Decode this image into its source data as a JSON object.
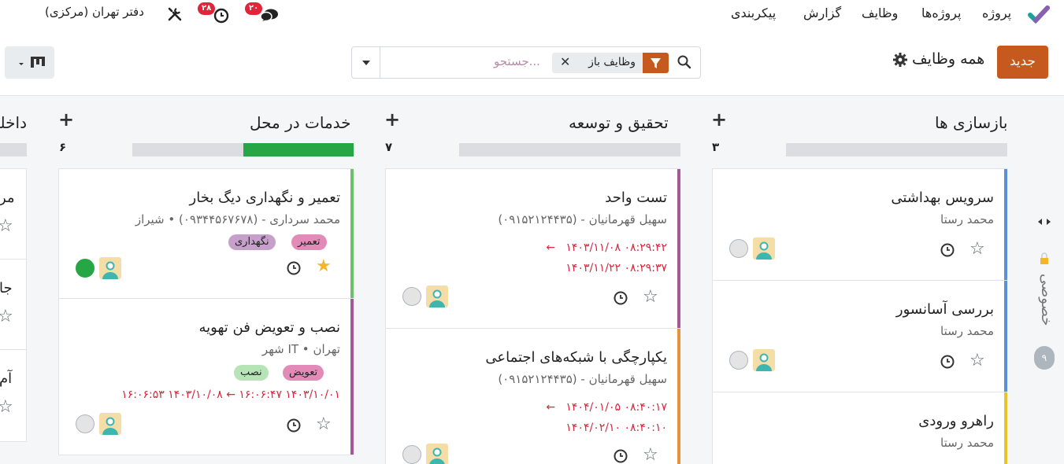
{
  "navbar": {
    "app_name": "پروژه",
    "menu": [
      "پروژه‌ها",
      "وظایف",
      "گزارش",
      "پیکربندی"
    ],
    "company": "دفتر تهران (مرکزی)",
    "messages_count": "۲۰",
    "activities_count": "۲۸"
  },
  "control": {
    "new_button": "جدید",
    "breadcrumb": "همه وظایف",
    "search_placeholder": "جستجو...",
    "facet_label": "وظایف باز",
    "accent_color": "#c65a1e"
  },
  "columns": [
    {
      "title": "بازسازی ها",
      "count": "۳",
      "progress_done": 0
    },
    {
      "title": "تحقیق و توسعه",
      "count": "۷",
      "progress_done": 0
    },
    {
      "title": "خدمات در محل",
      "count": "۶",
      "progress_done": 0.5
    },
    {
      "title": "داخلی",
      "count": ""
    }
  ],
  "cards": {
    "renovation": [
      {
        "title": "سرویس بهداشتی",
        "assignee": "محمد رستا"
      },
      {
        "title": "بررسی آسانسور",
        "assignee": "محمد رستا"
      },
      {
        "title": "راهرو ورودی",
        "assignee": "محمد رستا"
      }
    ],
    "rnd": [
      {
        "title": "تست واحد",
        "contact": "سهیل قهرمانیان - (۰۹۱۵۲۱۲۴۴۳۵)",
        "date_start": "۱۴۰۳/۱۱/۰۸ ۰۸:۲۹:۴۲",
        "date_end": "۱۴۰۳/۱۱/۲۲ ۰۸:۲۹:۳۷"
      },
      {
        "title": "یکپارچگی با شبکه‌های اجتماعی",
        "contact": "سهیل قهرمانیان - (۰۹۱۵۲۱۲۴۴۳۵)",
        "date_start": "۱۴۰۴/۰۱/۰۵ ۰۸:۴۰:۱۷",
        "date_end": "۱۴۰۴/۰۲/۱۰ ۰۸:۴۰:۱۰"
      }
    ],
    "onsite": [
      {
        "title": "تعمیر و نگهداری دیگ بخار",
        "contact": "محمد سرداری - (۰۹۳۴۴۵۶۷۶۷۸) • شیراز",
        "tags": [
          "تعمیر",
          "نگهداری"
        ]
      },
      {
        "title": "نصب و تعویض فن تهویه",
        "contact": "شهر IT • تهران",
        "tags": [
          "تعویض",
          "نصب"
        ],
        "date_range": "۱۶:۰۶:۵۳ ۱۴۰۳/۱۰/۰۸ ← ۱۶:۰۶:۴۷ ۱۴۰۳/۱۰/۰۱"
      }
    ],
    "internal_partial": [
      "مر",
      "جا",
      "آم"
    ]
  },
  "folded_column": {
    "title": "خصوصی",
    "count": "۹"
  }
}
